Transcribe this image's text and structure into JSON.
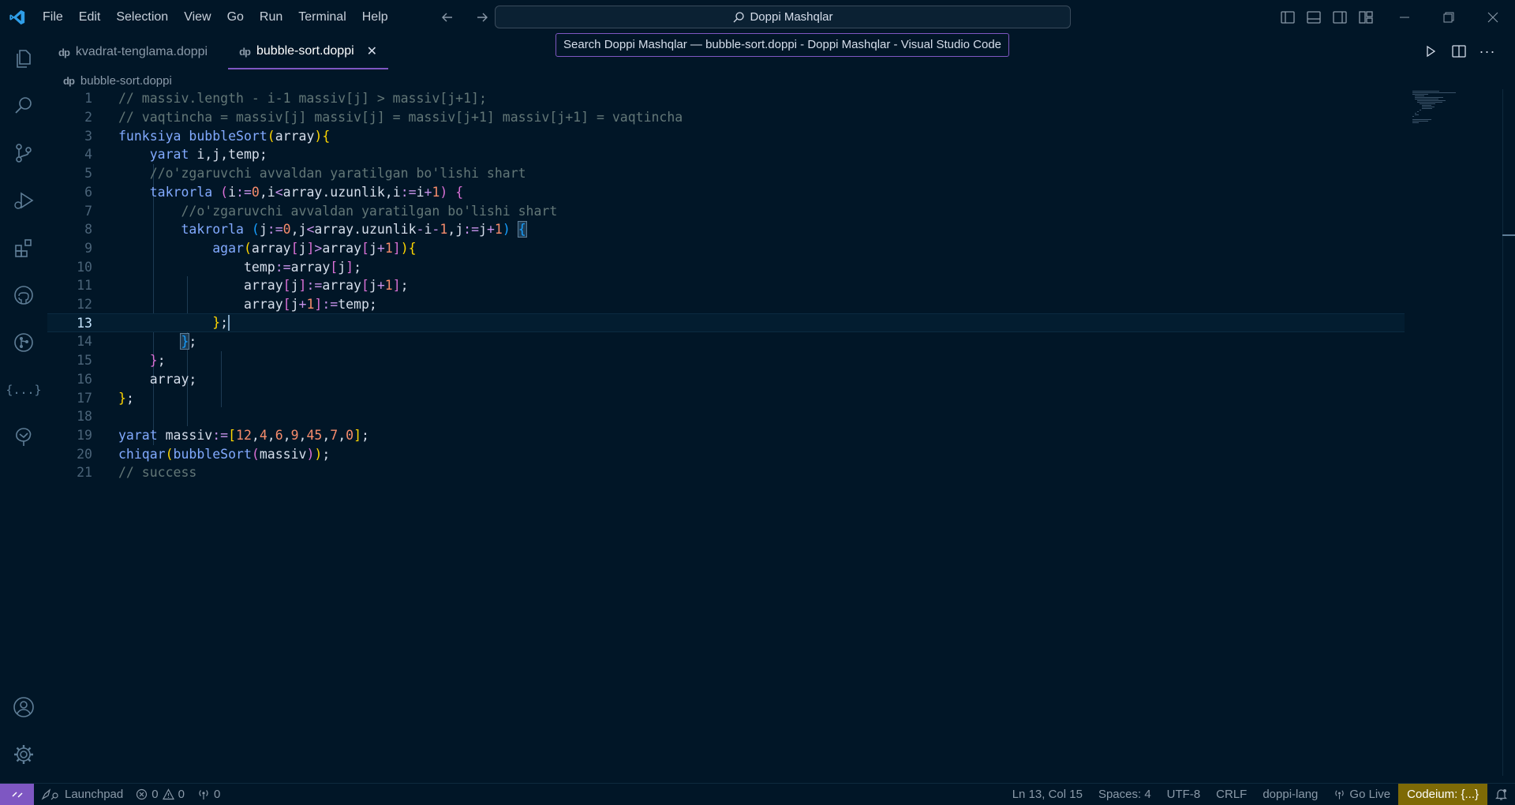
{
  "menu": [
    "File",
    "Edit",
    "Selection",
    "View",
    "Go",
    "Run",
    "Terminal",
    "Help"
  ],
  "command_center": {
    "label": "Doppi Mashqlar"
  },
  "tooltip": "Search Doppi Mashqlar — bubble-sort.doppi - Doppi Mashqlar - Visual Studio Code",
  "tabs": [
    {
      "label": "kvadrat-tenglama.doppi",
      "active": false
    },
    {
      "label": "bubble-sort.doppi",
      "active": true,
      "close": "✕"
    }
  ],
  "breadcrumb": {
    "file": "bubble-sort.doppi"
  },
  "editor": {
    "line_numbers": [
      "1",
      "2",
      "3",
      "4",
      "5",
      "6",
      "7",
      "8",
      "9",
      "10",
      "11",
      "12",
      "13",
      "14",
      "15",
      "16",
      "17",
      "18",
      "19",
      "20",
      "21"
    ],
    "current_line": 13,
    "lines": [
      "// massiv.length - i-1 massiv[j] > massiv[j+1];",
      "// vaqtincha = massiv[j] massiv[j] = massiv[j+1] massiv[j+1] = vaqtincha",
      "funksiya bubbleSort(array){",
      "    yarat i,j,temp;",
      "    //o'zgaruvchi avvaldan yaratilgan bo'lishi shart",
      "    takrorla (i:=0,i<array.uzunlik,i:=i+1) {",
      "        //o'zgaruvchi avvaldan yaratilgan bo'lishi shart",
      "        takrorla (j:=0,j<array.uzunlik-i-1,j:=j+1) {",
      "            agar(array[j]>array[j+1]){",
      "                temp:=array[j];",
      "                array[j]:=array[j+1];",
      "                array[j+1]:=temp;",
      "            };",
      "        };",
      "    };",
      "    array;",
      "};",
      "",
      "yarat massiv:=[12,4,6,9,45,7,0];",
      "chiqar(bubbleSort(massiv));",
      "// success"
    ]
  },
  "statusbar": {
    "launchpad": "Launchpad",
    "errors": "0",
    "warnings": "0",
    "ports": "0",
    "position": "Ln 13, Col 15",
    "spaces": "Spaces: 4",
    "encoding": "UTF-8",
    "eol": "CRLF",
    "language": "doppi-lang",
    "golive": "Go Live",
    "codeium": "Codeium: {...}"
  },
  "colors": {
    "background": "#011627",
    "accent": "#7e57c2",
    "comment": "#637777",
    "keyword": "#82aaff",
    "number": "#f78c6c",
    "codeium_bg": "#7e6a06"
  }
}
